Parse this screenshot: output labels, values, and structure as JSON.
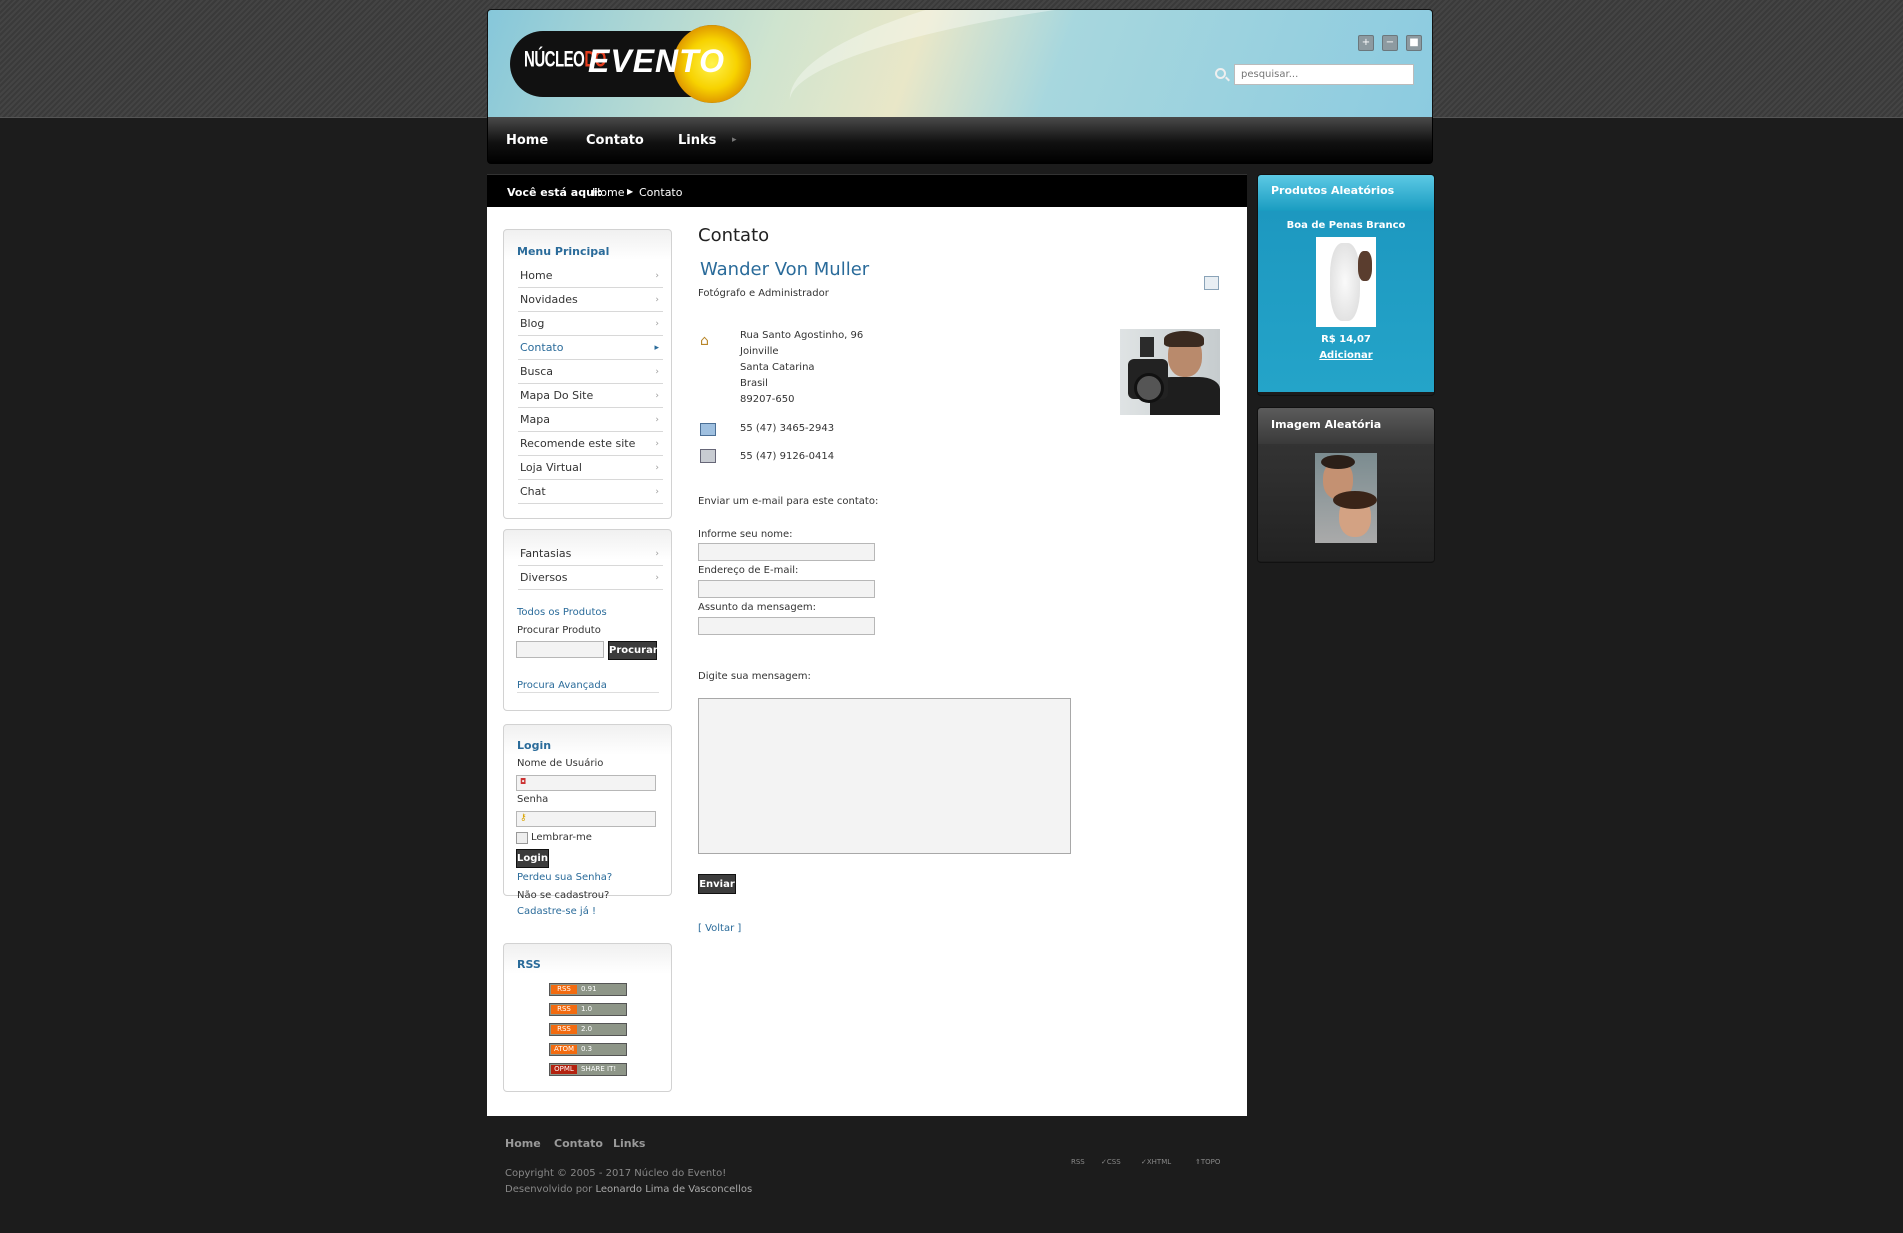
{
  "header": {
    "logo_small": "NÚCLEO",
    "logo_small_red": "DO",
    "logo_big": "EVENTO",
    "search_placeholder": "pesquisar...",
    "window_buttons": [
      "+",
      "−",
      "■"
    ]
  },
  "nav": {
    "items": [
      "Home",
      "Contato",
      "Links"
    ]
  },
  "breadcrumb": {
    "label": "Você está aqui:",
    "items": [
      "Home",
      "Contato"
    ]
  },
  "menu_principal": {
    "title": "Menu Principal",
    "items": [
      "Home",
      "Novidades",
      "Blog",
      "Contato",
      "Busca",
      "Mapa Do Site",
      "Mapa",
      "Recomende este site",
      "Loja Virtual",
      "Chat"
    ],
    "active": "Contato"
  },
  "shop": {
    "items": [
      "Fantasias",
      "Diversos"
    ],
    "all_products": "Todos os Produtos",
    "search_label": "Procurar Produto",
    "search_button": "Procurar",
    "advanced": "Procura Avançada"
  },
  "login": {
    "title": "Login",
    "user_label": "Nome de Usuário",
    "pass_label": "Senha",
    "remember": "Lembrar-me",
    "button": "Login",
    "forgot": "Perdeu sua Senha?",
    "no_account": "Não se cadastrou?",
    "register": "Cadastre-se já !"
  },
  "rss": {
    "title": "RSS",
    "badges": [
      {
        "left": "RSS",
        "right": "0.91"
      },
      {
        "left": "RSS",
        "right": "1.0"
      },
      {
        "left": "RSS",
        "right": "2.0"
      },
      {
        "left": "ATOM",
        "right": "0.3"
      },
      {
        "left": "OPML",
        "right": "SHARE IT!"
      }
    ]
  },
  "contact": {
    "page_title": "Contato",
    "name": "Wander Von Muller",
    "role": "Fotógrafo e Administrador",
    "address": [
      "Rua Santo Agostinho, 96",
      "Joinville",
      "Santa Catarina",
      "Brasil",
      "89207-650"
    ],
    "phone": "55 (47) 3465-2943",
    "fax": "55 (47) 9126-0414",
    "email_intro": "Enviar um e-mail para este contato:",
    "name_label": "Informe seu nome:",
    "email_label": "Endereço de E-mail:",
    "subject_label": "Assunto da mensagem:",
    "message_label": "Digite sua mensagem:",
    "send_button": "Enviar",
    "back_link": "[ Voltar ]"
  },
  "random_products": {
    "title": "Produtos Aleatórios",
    "product_name": "Boa de Penas Branco",
    "price": "R$ 14,07",
    "add": "Adicionar"
  },
  "random_image": {
    "title": "Imagem Aleatória"
  },
  "footer": {
    "links": [
      "Home",
      "Contato",
      "Links"
    ],
    "copyright": "Copyright © 2005 - 2017 Núcleo do Evento!",
    "dev_prefix": "Desenvolvido por",
    "dev_name": "Leonardo Lima de Vasconcellos",
    "badges": [
      "RSS",
      "CSS",
      "XHTML",
      "TOPO"
    ]
  },
  "colors": {
    "accent": "#2a6b9a",
    "product_blue": "#1d98c0",
    "background": "#1c1c1c"
  }
}
